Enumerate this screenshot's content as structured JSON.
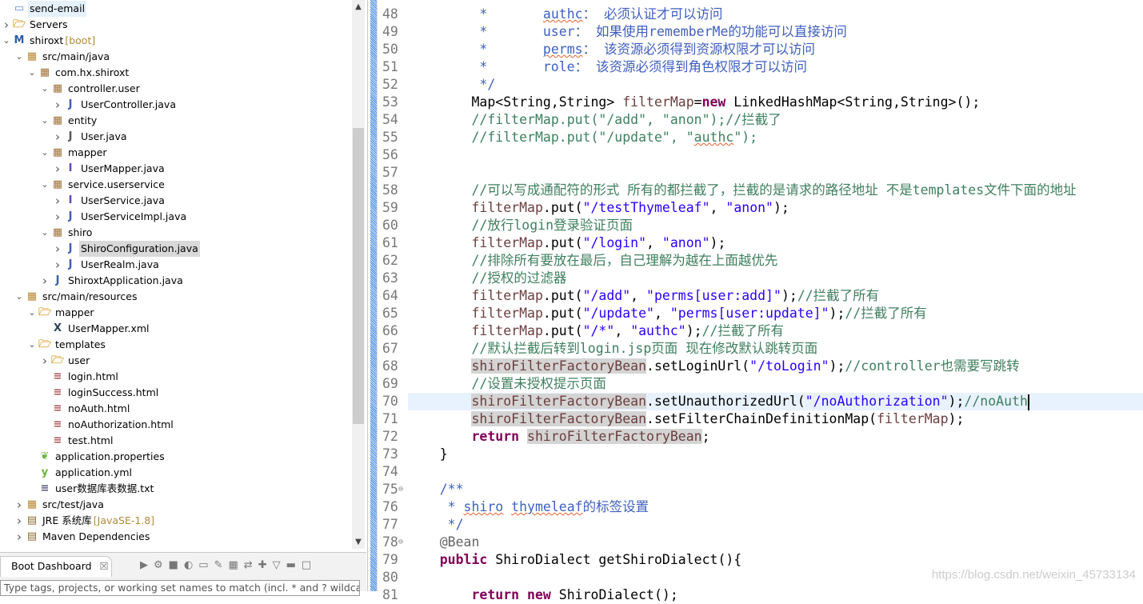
{
  "explorer": {
    "items": [
      {
        "label": "send-email",
        "level": 0,
        "chev": "",
        "icon": "project-icon",
        "first": true
      },
      {
        "label": "Servers",
        "level": 0,
        "chev": "right",
        "icon": "folder-icon"
      },
      {
        "label": "shiroxt",
        "decoration": "[boot]",
        "level": 0,
        "chev": "down",
        "icon": "maven-project-icon"
      },
      {
        "label": "src/main/java",
        "level": 1,
        "chev": "down",
        "icon": "source-folder-icon"
      },
      {
        "label": "com.hx.shiroxt",
        "level": 2,
        "chev": "down",
        "icon": "package-icon"
      },
      {
        "label": "controller.user",
        "level": 3,
        "chev": "down",
        "icon": "package-icon"
      },
      {
        "label": "UserController.java",
        "level": 4,
        "chev": "right",
        "icon": "java-class-icon"
      },
      {
        "label": "entity",
        "level": 3,
        "chev": "down",
        "icon": "package-icon"
      },
      {
        "label": "User.java",
        "level": 4,
        "chev": "right",
        "icon": "java-file-icon"
      },
      {
        "label": "mapper",
        "level": 3,
        "chev": "down",
        "icon": "package-icon"
      },
      {
        "label": "UserMapper.java",
        "level": 4,
        "chev": "right",
        "icon": "java-interface-icon"
      },
      {
        "label": "service.userservice",
        "level": 3,
        "chev": "down",
        "icon": "package-icon"
      },
      {
        "label": "UserService.java",
        "level": 4,
        "chev": "right",
        "icon": "java-interface-icon"
      },
      {
        "label": "UserServiceImpl.java",
        "level": 4,
        "chev": "right",
        "icon": "java-class-icon"
      },
      {
        "label": "shiro",
        "level": 3,
        "chev": "down",
        "icon": "package-icon"
      },
      {
        "label": "ShiroConfiguration.java",
        "level": 4,
        "chev": "right",
        "icon": "java-class-icon",
        "selected": true
      },
      {
        "label": "UserRealm.java",
        "level": 4,
        "chev": "right",
        "icon": "java-class-icon"
      },
      {
        "label": "ShiroxtApplication.java",
        "level": 3,
        "chev": "right",
        "icon": "java-class-icon"
      },
      {
        "label": "src/main/resources",
        "level": 1,
        "chev": "down",
        "icon": "source-folder-icon"
      },
      {
        "label": "mapper",
        "level": 2,
        "chev": "down",
        "icon": "folder-icon"
      },
      {
        "label": "UserMapper.xml",
        "level": 3,
        "chev": "",
        "icon": "xml-file-icon"
      },
      {
        "label": "templates",
        "level": 2,
        "chev": "down",
        "icon": "folder-icon"
      },
      {
        "label": "user",
        "level": 3,
        "chev": "right",
        "icon": "folder-icon"
      },
      {
        "label": "login.html",
        "level": 3,
        "chev": "",
        "icon": "html-file-icon"
      },
      {
        "label": "loginSuccess.html",
        "level": 3,
        "chev": "",
        "icon": "html-file-icon"
      },
      {
        "label": "noAuth.html",
        "level": 3,
        "chev": "",
        "icon": "html-file-icon"
      },
      {
        "label": "noAuthorization.html",
        "level": 3,
        "chev": "",
        "icon": "html-file-icon"
      },
      {
        "label": "test.html",
        "level": 3,
        "chev": "",
        "icon": "html-file-icon"
      },
      {
        "label": "application.properties",
        "level": 2,
        "chev": "",
        "icon": "spring-properties-icon"
      },
      {
        "label": "application.yml",
        "level": 2,
        "chev": "",
        "icon": "spring-yml-icon"
      },
      {
        "label": "user数据库表数据.txt",
        "level": 2,
        "chev": "",
        "icon": "text-file-icon"
      },
      {
        "label": "src/test/java",
        "level": 1,
        "chev": "right",
        "icon": "source-folder-icon"
      },
      {
        "label": "JRE 系统库",
        "decoration": "[JavaSE-1.8]",
        "level": 1,
        "chev": "right",
        "icon": "library-icon"
      },
      {
        "label": "Maven Dependencies",
        "level": 1,
        "chev": "right",
        "icon": "library-icon"
      }
    ]
  },
  "dashboard": {
    "tab_label": "Boot Dashboard",
    "close_glyph": "☒",
    "filter_placeholder": "Type tags, projects, or working set names to match (incl. * and ? wildcards)",
    "tools": [
      "▶",
      "⚙",
      "■",
      "◐",
      "▭",
      "✎",
      "▦",
      "⇄",
      "✚",
      "▽",
      "▬",
      "□"
    ]
  },
  "editor": {
    "current_line": 70,
    "lines": [
      {
        "n": 48,
        "t": [
          [
            "plain",
            "         "
          ],
          [
            "doc",
            "*       "
          ],
          [
            "doc sq",
            "authc"
          ],
          [
            "doc",
            "： 必须认证才可以访问"
          ]
        ]
      },
      {
        "n": 49,
        "t": [
          [
            "plain",
            "         "
          ],
          [
            "doc",
            "*       user： 如果使用rememberMe的功能可以直接访问"
          ]
        ]
      },
      {
        "n": 50,
        "t": [
          [
            "plain",
            "         "
          ],
          [
            "doc",
            "*       "
          ],
          [
            "doc sq",
            "perms"
          ],
          [
            "doc",
            "： 该资源必须得到资源权限才可以访问"
          ]
        ]
      },
      {
        "n": 51,
        "t": [
          [
            "plain",
            "         "
          ],
          [
            "doc",
            "*       role： 该资源必须得到角色权限才可以访问"
          ]
        ]
      },
      {
        "n": 52,
        "t": [
          [
            "plain",
            "         "
          ],
          [
            "doc",
            "*/"
          ]
        ]
      },
      {
        "n": 53,
        "t": [
          [
            "plain",
            "        Map<String,String> "
          ],
          [
            "var",
            "filterMap"
          ],
          [
            "plain",
            "="
          ],
          [
            "kw",
            "new"
          ],
          [
            "plain",
            " LinkedHashMap<String,String>();"
          ]
        ]
      },
      {
        "n": 54,
        "t": [
          [
            "plain",
            "        "
          ],
          [
            "com",
            "//filterMap.put(\"/add\", \"anon\");//拦截了"
          ]
        ]
      },
      {
        "n": 55,
        "t": [
          [
            "plain",
            "        "
          ],
          [
            "com",
            "//filterMap.put(\"/update\", \""
          ],
          [
            "com sq",
            "authc"
          ],
          [
            "com",
            "\");"
          ]
        ]
      },
      {
        "n": 56,
        "t": []
      },
      {
        "n": 57,
        "t": []
      },
      {
        "n": 58,
        "t": [
          [
            "plain",
            "        "
          ],
          [
            "com",
            "//可以写成通配符的形式 所有的都拦截了，拦截的是请求的路径地址 不是templates文件下面的地址"
          ]
        ]
      },
      {
        "n": 59,
        "t": [
          [
            "plain",
            "        "
          ],
          [
            "var",
            "filterMap"
          ],
          [
            "plain",
            ".put("
          ],
          [
            "str",
            "\"/testThymeleaf\""
          ],
          [
            "plain",
            ", "
          ],
          [
            "str",
            "\"anon\""
          ],
          [
            "plain",
            ");"
          ]
        ]
      },
      {
        "n": 60,
        "t": [
          [
            "plain",
            "        "
          ],
          [
            "com",
            "//放行login登录验证页面"
          ]
        ]
      },
      {
        "n": 61,
        "t": [
          [
            "plain",
            "        "
          ],
          [
            "var",
            "filterMap"
          ],
          [
            "plain",
            ".put("
          ],
          [
            "str",
            "\"/login\""
          ],
          [
            "plain",
            ", "
          ],
          [
            "str",
            "\"anon\""
          ],
          [
            "plain",
            ");"
          ]
        ]
      },
      {
        "n": 62,
        "t": [
          [
            "plain",
            "        "
          ],
          [
            "com",
            "//排除所有要放在最后，自己理解为越在上面越优先"
          ]
        ]
      },
      {
        "n": 63,
        "t": [
          [
            "plain",
            "        "
          ],
          [
            "com",
            "//授权的过滤器"
          ]
        ]
      },
      {
        "n": 64,
        "t": [
          [
            "plain",
            "        "
          ],
          [
            "var",
            "filterMap"
          ],
          [
            "plain",
            ".put("
          ],
          [
            "str",
            "\"/add\""
          ],
          [
            "plain",
            ", "
          ],
          [
            "str",
            "\"perms[user:add]\""
          ],
          [
            "plain",
            ");"
          ],
          [
            "com",
            "//拦截了所有"
          ]
        ]
      },
      {
        "n": 65,
        "t": [
          [
            "plain",
            "        "
          ],
          [
            "var",
            "filterMap"
          ],
          [
            "plain",
            ".put("
          ],
          [
            "str",
            "\"/update\""
          ],
          [
            "plain",
            ", "
          ],
          [
            "str",
            "\"perms[user:update]\""
          ],
          [
            "plain",
            ");"
          ],
          [
            "com",
            "//拦截了所有"
          ]
        ]
      },
      {
        "n": 66,
        "t": [
          [
            "plain",
            "        "
          ],
          [
            "var",
            "filterMap"
          ],
          [
            "plain",
            ".put("
          ],
          [
            "str",
            "\"/*\""
          ],
          [
            "plain",
            ", "
          ],
          [
            "str",
            "\"authc\""
          ],
          [
            "plain",
            ");"
          ],
          [
            "com",
            "//拦截了所有"
          ]
        ]
      },
      {
        "n": 67,
        "t": [
          [
            "plain",
            "        "
          ],
          [
            "com",
            "//默认拦截后转到login.jsp页面 现在修改默认跳转页面"
          ]
        ]
      },
      {
        "n": 68,
        "t": [
          [
            "plain",
            "        "
          ],
          [
            "var hl",
            "shiroFilterFactoryBean"
          ],
          [
            "plain",
            ".setLoginUrl("
          ],
          [
            "str",
            "\"/toLogin\""
          ],
          [
            "plain",
            ");"
          ],
          [
            "com",
            "//controller也需要写跳转"
          ]
        ]
      },
      {
        "n": 69,
        "t": [
          [
            "plain",
            "        "
          ],
          [
            "com",
            "//设置未授权提示页面"
          ]
        ]
      },
      {
        "n": 70,
        "t": [
          [
            "plain",
            "        "
          ],
          [
            "var hl",
            "shiroFilterFactoryBean"
          ],
          [
            "plain",
            ".setUnauthorizedUrl("
          ],
          [
            "str",
            "\"/noAuthorization\""
          ],
          [
            "plain",
            ");"
          ],
          [
            "com",
            "//noAuth"
          ]
        ]
      },
      {
        "n": 71,
        "t": [
          [
            "plain",
            "        "
          ],
          [
            "var hl",
            "shiroFilterFactoryBean"
          ],
          [
            "plain",
            ".setFilterChainDefinitionMap("
          ],
          [
            "var",
            "filterMap"
          ],
          [
            "plain",
            ");"
          ]
        ]
      },
      {
        "n": 72,
        "t": [
          [
            "plain",
            "        "
          ],
          [
            "kw",
            "return"
          ],
          [
            "plain",
            " "
          ],
          [
            "var hl",
            "shiroFilterFactoryBean"
          ],
          [
            "plain",
            ";"
          ]
        ]
      },
      {
        "n": 73,
        "t": [
          [
            "plain",
            "    }"
          ]
        ]
      },
      {
        "n": 74,
        "t": []
      },
      {
        "n": 75,
        "fold": true,
        "t": [
          [
            "plain",
            "    "
          ],
          [
            "doc",
            "/**"
          ]
        ]
      },
      {
        "n": 76,
        "t": [
          [
            "plain",
            "     "
          ],
          [
            "doc",
            "* "
          ],
          [
            "doc sq",
            "shiro"
          ],
          [
            "doc",
            " "
          ],
          [
            "doc sq",
            "thymeleaf"
          ],
          [
            "doc",
            "的标签设置"
          ]
        ]
      },
      {
        "n": 77,
        "t": [
          [
            "plain",
            "     "
          ],
          [
            "doc",
            "*/"
          ]
        ]
      },
      {
        "n": 78,
        "fold": true,
        "t": [
          [
            "plain",
            "    "
          ],
          [
            "ann",
            "@Bean"
          ]
        ]
      },
      {
        "n": 79,
        "t": [
          [
            "plain",
            "    "
          ],
          [
            "kw",
            "public"
          ],
          [
            "plain",
            " ShiroDialect getShiroDialect(){"
          ]
        ]
      },
      {
        "n": 80,
        "t": []
      },
      {
        "n": 81,
        "t": [
          [
            "plain",
            "        "
          ],
          [
            "kw",
            "return"
          ],
          [
            "plain",
            " "
          ],
          [
            "kw",
            "new"
          ],
          [
            "plain",
            " ShiroDialect();"
          ]
        ]
      }
    ]
  },
  "watermark": "https://blog.csdn.net/weixin_45733134"
}
